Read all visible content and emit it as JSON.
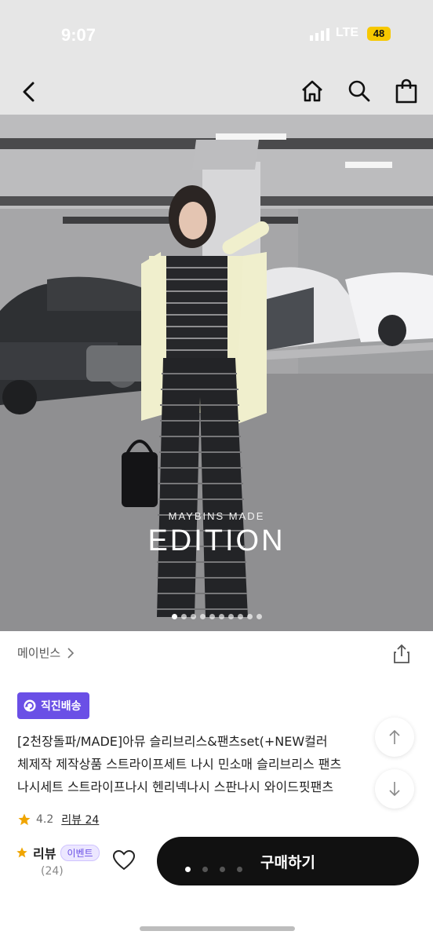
{
  "status_bar": {
    "time": "9:07",
    "network": "LTE",
    "battery": "48"
  },
  "nav": {
    "back_icon": "chevron-left-icon",
    "home_icon": "home-icon",
    "search_icon": "search-icon",
    "bag_icon": "shopping-bag-icon"
  },
  "banner": {
    "brand_sub": "MAYBINS MADE",
    "brand_main": "EDITION",
    "total_images": 10,
    "current_image": 1
  },
  "product": {
    "seller": "메이빈스",
    "badge": "직진배송",
    "title_lines": [
      "[2천장돌파/MADE]아뮤 슬리브리스&팬츠set(+NEW컬러",
      "체제작 제작상품 스트라이프세트 나시 민소매 슬리브리스 팬츠",
      "나시세트 스트라이프나시 헨리넥나시 스판나시 와이드핏팬츠"
    ],
    "rating": "4.2",
    "review_link": "리뷰 24"
  },
  "bottom_bar": {
    "review_label": "리뷰",
    "event_badge": "이벤트",
    "review_count": "(24)",
    "buy_label": "구매하기",
    "page_dots": 4,
    "active_dot": 1
  },
  "colors": {
    "accent": "#6a4fe6",
    "buy_button": "#111111",
    "star": "#f0a500"
  }
}
